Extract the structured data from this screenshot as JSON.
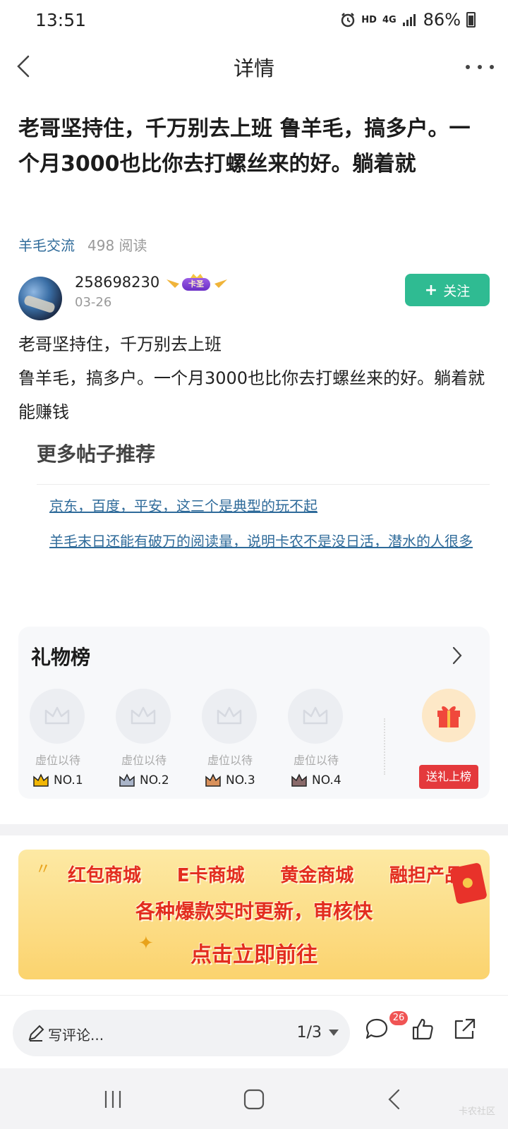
{
  "status_bar": {
    "time": "13:51",
    "hd": "HD",
    "network": "4G",
    "battery": "86%"
  },
  "header": {
    "title": "详情"
  },
  "post": {
    "title": "老哥坚持住，千万别去上班 鲁羊毛，搞多户。一个月3000也比你去打螺丝来的好。躺着就",
    "category": "羊毛交流",
    "read_count": "498 阅读",
    "author_name": "258698230",
    "badge_label": "卡圣",
    "date": "03-26",
    "follow_label": "关注",
    "body_line1": "老哥坚持住，千万别去上班",
    "body_line2": "鲁羊毛，搞多户。一个月3000也比你去打螺丝来的好。躺着就能赚钱"
  },
  "recommend": {
    "title": "更多帖子推荐",
    "items": [
      "京东，百度，平安，这三个是典型的玩不起",
      "羊毛末日还能有破万的阅读量，说明卡农不是没日活，潜水的人很多"
    ]
  },
  "gift_board": {
    "title": "礼物榜",
    "slots": [
      {
        "text": "虚位以待",
        "rank": "NO.1",
        "crown_color": "#f2b705"
      },
      {
        "text": "虚位以待",
        "rank": "NO.2",
        "crown_color": "#a9b4c8"
      },
      {
        "text": "虚位以待",
        "rank": "NO.3",
        "crown_color": "#d9915b"
      },
      {
        "text": "虚位以待",
        "rank": "NO.4",
        "crown_color": "#8a6a6a"
      }
    ],
    "send_label": "送礼上榜"
  },
  "banner": {
    "items": [
      "红包商城",
      "E卡商城",
      "黄金商城",
      "融担产品"
    ],
    "line2": "各种爆款实时更新，审核快",
    "line3": "点击立即前往"
  },
  "bottom_bar": {
    "comment_placeholder": "写评论...",
    "page_indicator": "1/3",
    "comment_count": "26"
  },
  "colors": {
    "accent_green": "#2fbb92",
    "link_blue": "#2f6b9a",
    "red": "#e4393c"
  },
  "watermark": "卡农社区"
}
